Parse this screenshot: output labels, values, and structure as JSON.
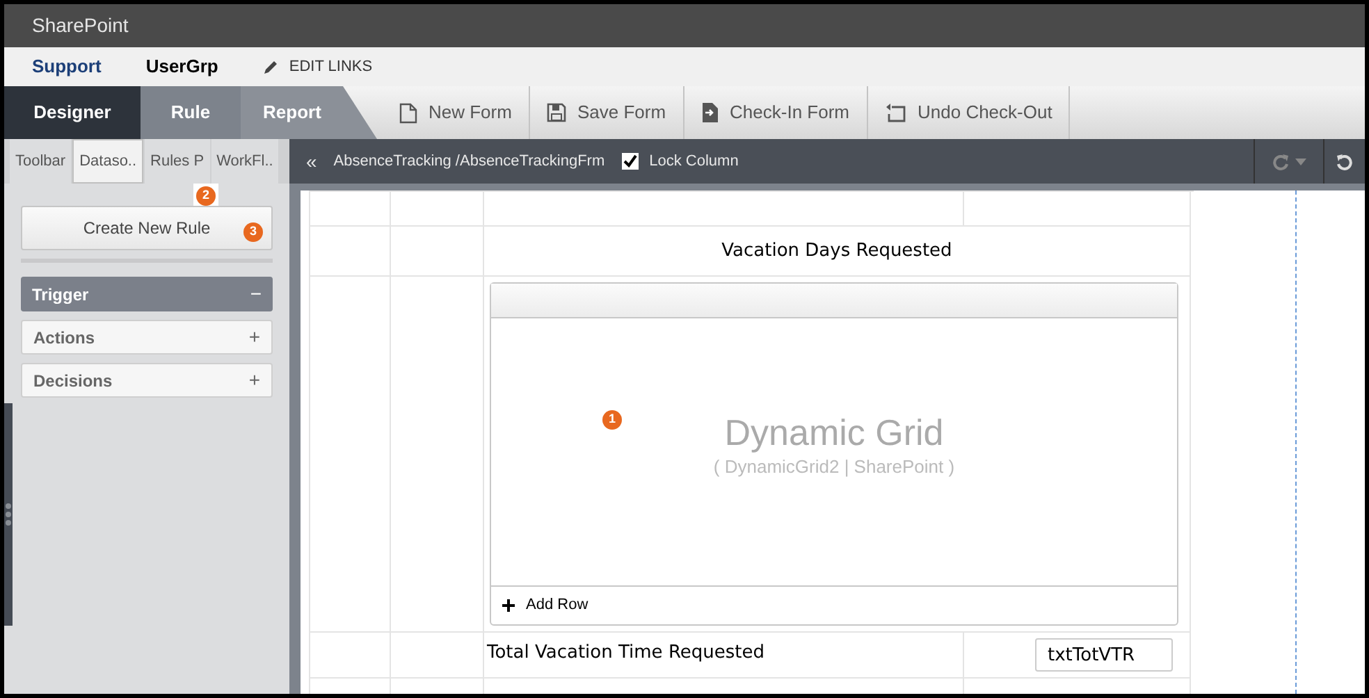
{
  "app_title": "SharePoint",
  "nav_links": [
    {
      "label": "Support",
      "selected": true
    },
    {
      "label": "UserGrp",
      "selected": false
    }
  ],
  "edit_links": "EDIT LINKS",
  "mode_tabs": [
    {
      "label": "Designer",
      "selected": true
    },
    {
      "label": "Rule",
      "selected": false
    },
    {
      "label": "Report",
      "selected": false
    }
  ],
  "toolbar": [
    {
      "label": "New Form",
      "kind": "new"
    },
    {
      "label": "Save Form",
      "kind": "save"
    },
    {
      "label": "Check-In Form",
      "kind": "checkin"
    },
    {
      "label": "Undo Check-Out",
      "kind": "undo"
    }
  ],
  "panel_tabs": [
    {
      "label": "Toolbar",
      "selected": false
    },
    {
      "label": "Dataso..",
      "selected": true
    },
    {
      "label": "Rules P",
      "selected": false,
      "badge": "2"
    },
    {
      "label": "WorkFl..",
      "selected": false
    }
  ],
  "collapse_glyph": "«",
  "breadcrumb": "AbsenceTracking /AbsenceTrackingFrm",
  "lock_column": {
    "label": "Lock Column",
    "checked": true
  },
  "create_rule": {
    "label": "Create New Rule",
    "badge": "3"
  },
  "sections": [
    {
      "label": "Trigger",
      "expanded": true,
      "toggle": "−"
    },
    {
      "label": "Actions",
      "expanded": false,
      "toggle": "+"
    },
    {
      "label": "Decisions",
      "expanded": false,
      "toggle": "+"
    }
  ],
  "form": {
    "heading": "Vacation Days Requested",
    "grid": {
      "title": "Dynamic Grid",
      "subtitle": "( DynamicGrid2 | SharePoint )",
      "badge": "1",
      "add_row": "Add Row"
    },
    "total_label": "Total Vacation Time Requested",
    "total_field": "txtTotVTR"
  }
}
